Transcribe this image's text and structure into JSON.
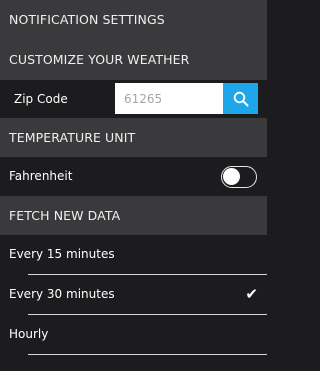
{
  "sections": {
    "notification": "NOTIFICATION SETTINGS",
    "customize": "CUSTOMIZE YOUR WEATHER",
    "temperature": "TEMPERATURE UNIT",
    "fetch": "FETCH NEW DATA"
  },
  "zip": {
    "label": "Zip Code",
    "placeholder": "61265",
    "search_icon": "search-icon"
  },
  "temperature": {
    "label": "Fahrenheit",
    "toggle_on": false
  },
  "fetch_options": [
    {
      "label": "Every 15 minutes",
      "selected": false
    },
    {
      "label": "Every 30 minutes",
      "selected": true
    },
    {
      "label": "Hourly",
      "selected": false
    }
  ],
  "checkmark": "✔",
  "colors": {
    "accent": "#1ea7e8",
    "header_bg": "#3a3a3c",
    "row_bg": "#1c1c1e"
  }
}
